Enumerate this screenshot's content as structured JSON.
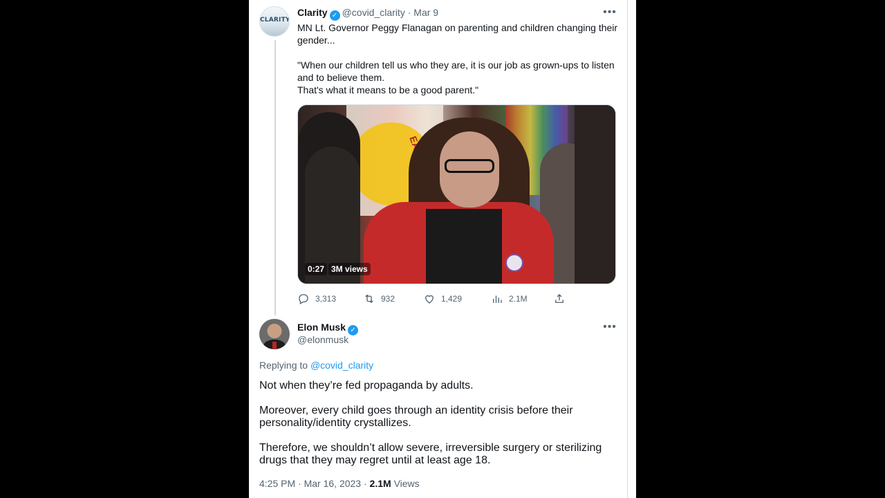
{
  "tweet1": {
    "author_name": "Clarity",
    "handle": "@covid_clarity",
    "separator": "·",
    "date": "Mar 9",
    "avatar_logo": "CLARITY",
    "text_lines": [
      "MN Lt. Governor Peggy Flanagan on parenting and children changing their gender...",
      "",
      "\"When our children tell us who they are, it is our job as grown-ups to listen and to believe them.",
      "That's what it means to be a good parent.\""
    ],
    "video": {
      "duration": "0:27",
      "views": "3M views",
      "flag_text": "EARTH"
    },
    "actions": {
      "replies": "3,313",
      "retweets": "932",
      "likes": "1,429",
      "views": "2.1M"
    },
    "more_icon": "more-dots-icon"
  },
  "tweet2": {
    "author_name": "Elon Musk",
    "handle": "@elonmusk",
    "replying_prefix": "Replying to",
    "replying_to": "@covid_clarity",
    "paragraphs": [
      "Not when they’re fed propaganda by adults.",
      "Moreover, every child goes through an identity crisis before their personality/identity crystallizes.",
      "Therefore, we shouldn’t allow severe, irreversible surgery or sterilizing drugs that they may regret until at least age 18."
    ],
    "time": "4:25 PM",
    "separator": "·",
    "date": "Mar 16, 2023",
    "views_count": "2.1M",
    "views_label": "Views"
  },
  "colors": {
    "accent": "#1d9bf0",
    "text_primary": "#0f1419",
    "text_secondary": "#536471",
    "border": "#cfd9de",
    "background": "#ffffff",
    "letterbox": "#000000"
  }
}
